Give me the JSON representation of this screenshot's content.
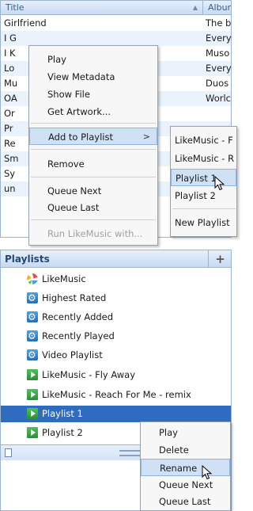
{
  "track_list": {
    "columns": {
      "title": "Title",
      "album": "Album"
    },
    "rows": [
      {
        "title": "Girlfriend",
        "album": "The b"
      },
      {
        "title": "I G",
        "album": "Every"
      },
      {
        "title": "I K",
        "album": "Muso"
      },
      {
        "title": "Lo",
        "album": "Every"
      },
      {
        "title": "Mu",
        "album": "Duos"
      },
      {
        "title": "OA",
        "album": "Worlc"
      },
      {
        "title": "Or",
        "album": ""
      },
      {
        "title": "Pr",
        "album": ""
      },
      {
        "title": "Re",
        "album": ""
      },
      {
        "title": "Sm",
        "album": ""
      },
      {
        "title": "Sy",
        "album": ""
      },
      {
        "title": "un",
        "album": ""
      },
      {
        "title": "",
        "album": ""
      }
    ]
  },
  "context_menu": {
    "items": [
      {
        "label": "Play"
      },
      {
        "label": "View Metadata"
      },
      {
        "label": "Show File"
      },
      {
        "label": "Get Artwork..."
      },
      {
        "label": "Add to Playlist",
        "submenu_arrow": ">"
      },
      {
        "label": "Remove"
      },
      {
        "label": "Queue Next"
      },
      {
        "label": "Queue Last"
      },
      {
        "label": "Run LikeMusic with..."
      }
    ]
  },
  "submenu": {
    "items": [
      {
        "label": "LikeMusic - F"
      },
      {
        "label": "LikeMusic - R"
      },
      {
        "label": "Playlist 1"
      },
      {
        "label": "Playlist 2"
      },
      {
        "label": "New Playlist"
      }
    ]
  },
  "playlists_panel": {
    "title": "Playlists",
    "add_label": "+",
    "items": [
      {
        "label": "LikeMusic",
        "icon": "likemusic-icon"
      },
      {
        "label": "Highest Rated",
        "icon": "smart-playlist-icon"
      },
      {
        "label": "Recently Added",
        "icon": "smart-playlist-icon"
      },
      {
        "label": "Recently Played",
        "icon": "smart-playlist-icon"
      },
      {
        "label": "Video Playlist",
        "icon": "smart-playlist-icon"
      },
      {
        "label": "LikeMusic - Fly Away",
        "icon": "playlist-icon"
      },
      {
        "label": "LikeMusic - Reach For Me - remix",
        "icon": "playlist-icon"
      },
      {
        "label": "Playlist 1",
        "icon": "playlist-icon"
      },
      {
        "label": "Playlist 2",
        "icon": "playlist-icon"
      }
    ]
  },
  "playlist_context_menu": {
    "items": [
      {
        "label": "Play"
      },
      {
        "label": "Delete"
      },
      {
        "label": "Rename"
      },
      {
        "label": "Queue Next"
      },
      {
        "label": "Queue Last"
      }
    ]
  },
  "colors": {
    "selection": "#2f6cc0",
    "header_gradient_top": "#e6f0fb",
    "header_gradient_bottom": "#c7dbf2",
    "menu_highlight": "#cfe1f5"
  }
}
